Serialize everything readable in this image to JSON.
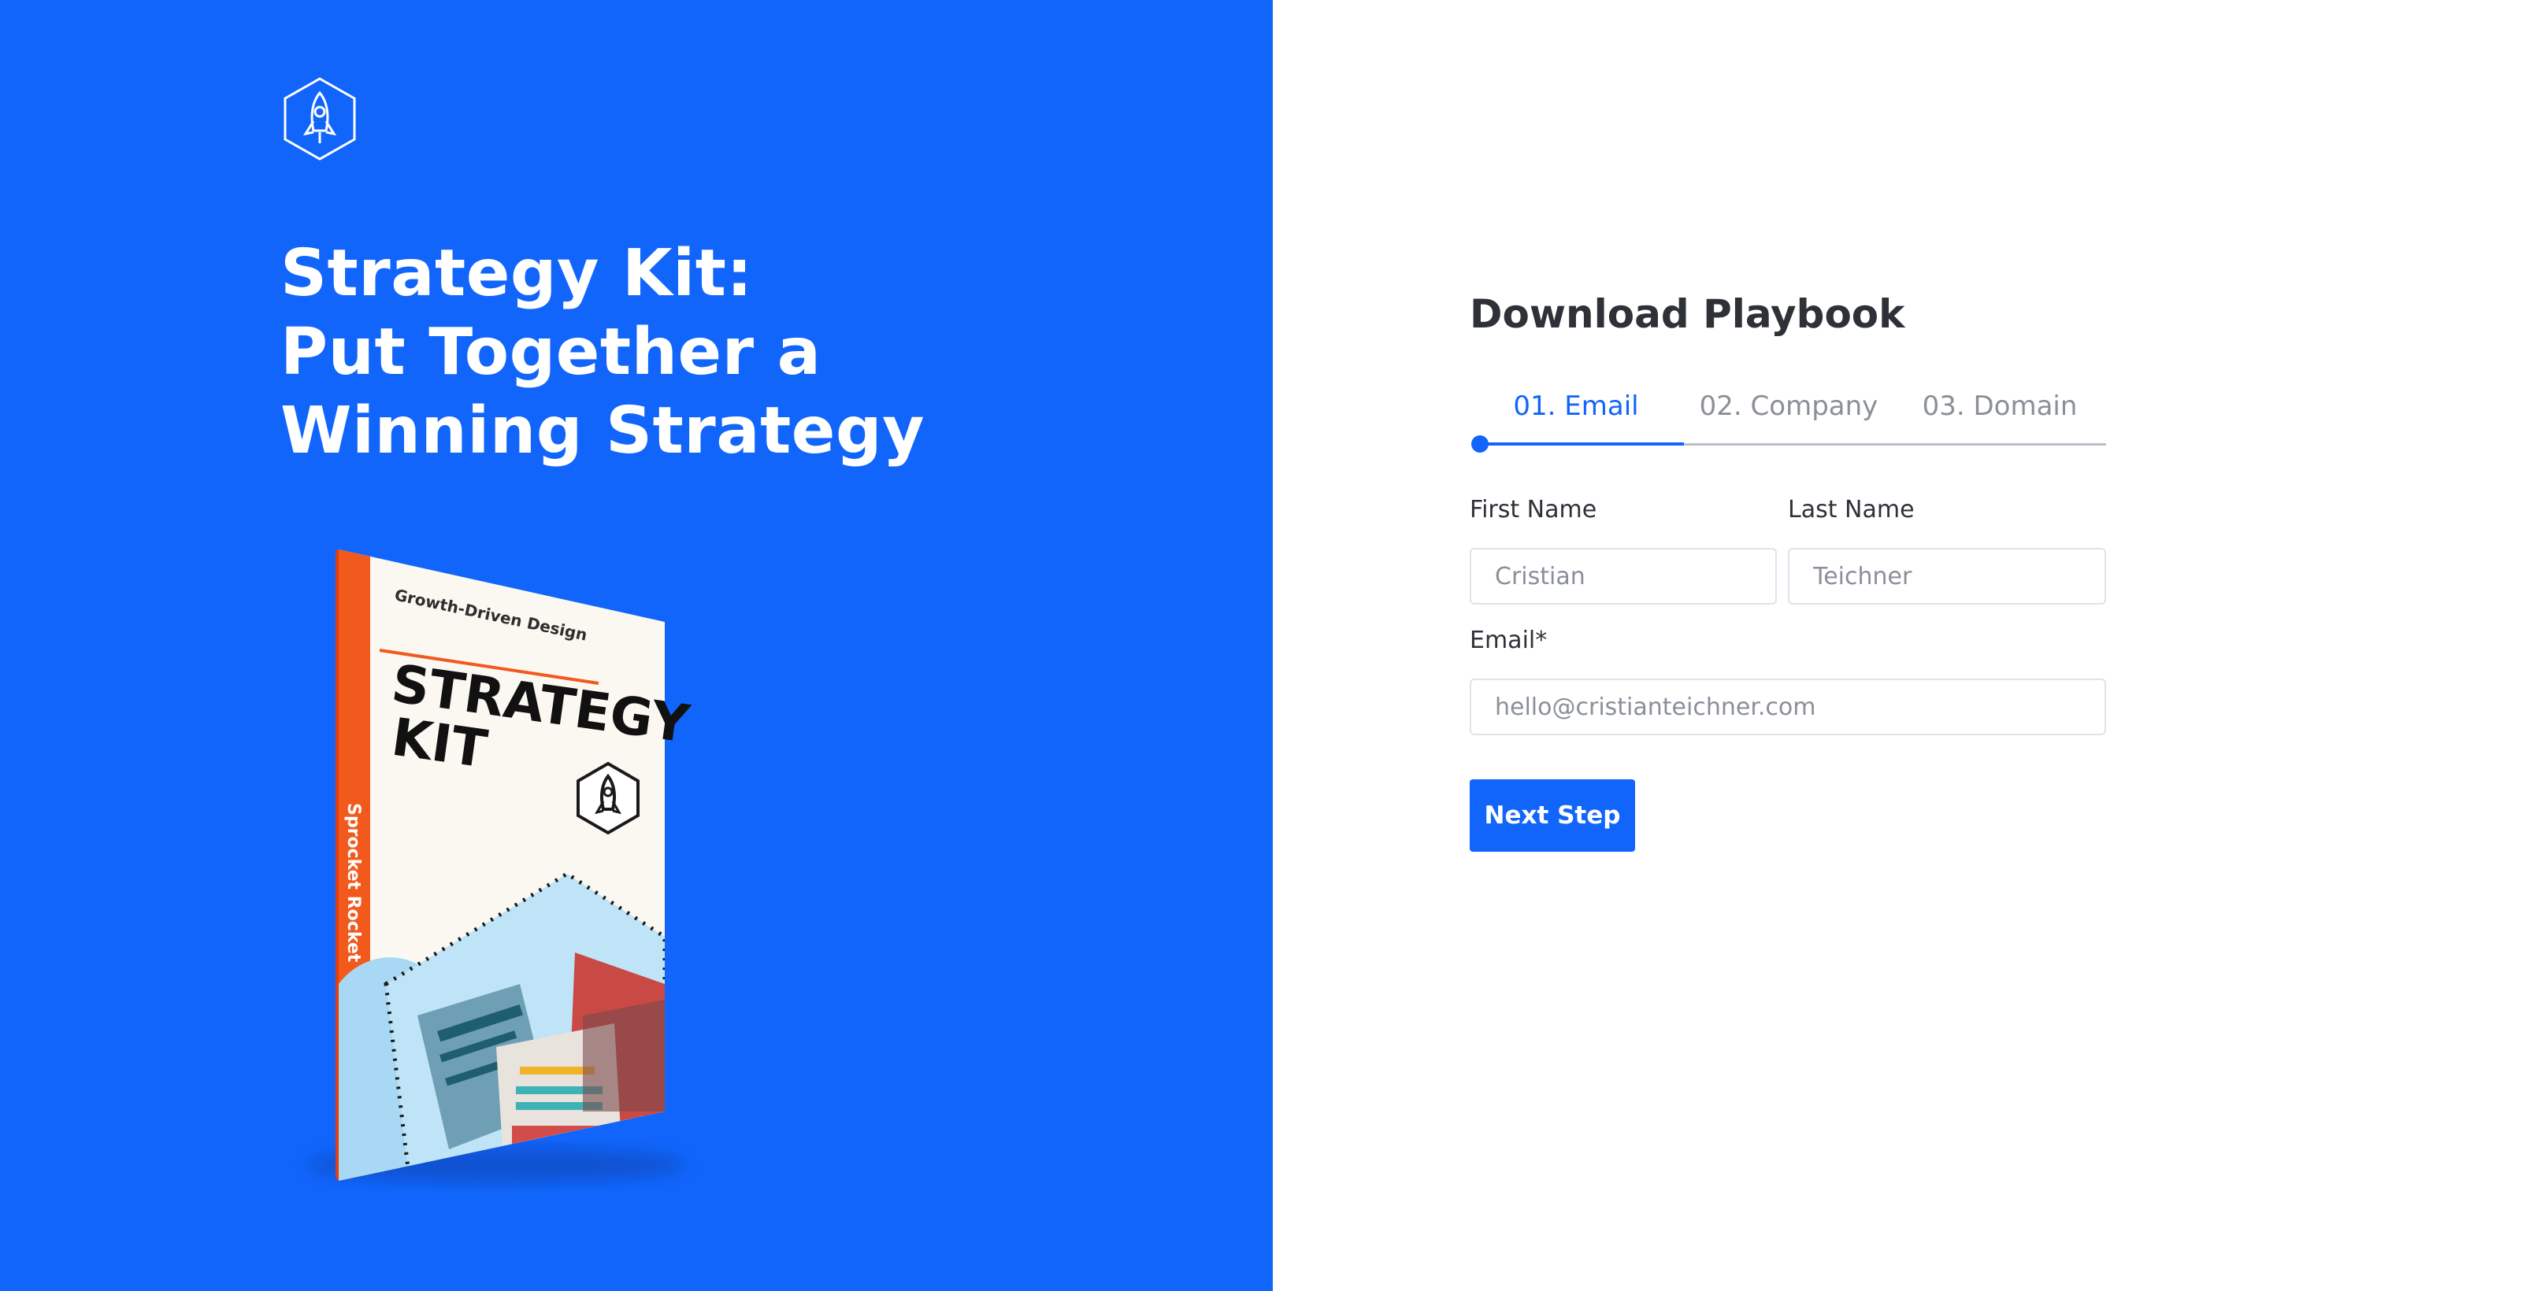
{
  "colors": {
    "brand_blue": "#1265fb",
    "title_text": "#2e3138",
    "muted_text": "#8a8f99",
    "input_border": "#dfe3ea"
  },
  "hero": {
    "logo_icon": "rocket-hexagon-icon",
    "headline_lines": [
      "Strategy Kit:",
      "Put Together a",
      "Winning Strategy"
    ],
    "book_cover": {
      "series": "Growth-Driven Design",
      "title_line_1": "STRATEGY",
      "title_line_2": "KIT",
      "spine_text": "Sprocket Rocket"
    }
  },
  "form": {
    "title": "Download Playbook",
    "steps": [
      {
        "label": "01. Email",
        "active": true
      },
      {
        "label": "02. Company",
        "active": false
      },
      {
        "label": "03. Domain",
        "active": false
      }
    ],
    "first_name": {
      "label": "First Name",
      "placeholder": "Cristian"
    },
    "last_name": {
      "label": "Last Name",
      "placeholder": "Teichner"
    },
    "email": {
      "label": "Email*",
      "placeholder": "hello@cristianteichner.com"
    },
    "submit_label": "Next Step"
  }
}
